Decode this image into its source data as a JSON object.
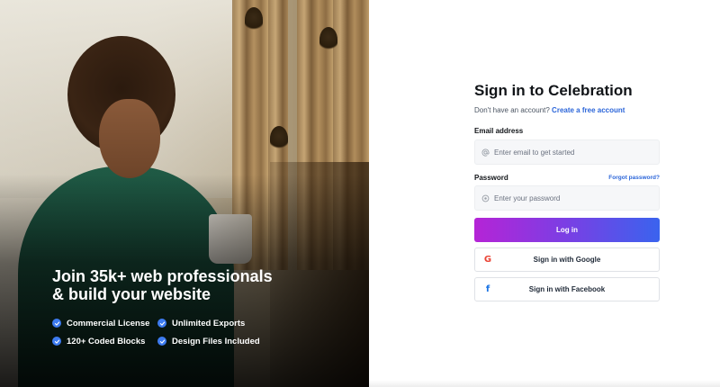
{
  "hero": {
    "title_line1": "Join 35k+ web professionals",
    "title_line2": "& build your website",
    "features": [
      {
        "label": "Commercial License",
        "icon": "check-circle-icon"
      },
      {
        "label": "Unlimited Exports",
        "icon": "check-circle-icon"
      },
      {
        "label": "120+ Coded Blocks",
        "icon": "check-circle-icon"
      },
      {
        "label": "Design Files Included",
        "icon": "check-circle-icon"
      }
    ]
  },
  "form": {
    "title": "Sign in to Celebration",
    "subtitle_text": "Don't have an account?",
    "subtitle_link": "Create a free account",
    "email": {
      "label": "Email address",
      "placeholder": "Enter email to get started",
      "value": "",
      "icon": "at-sign-icon"
    },
    "password": {
      "label": "Password",
      "placeholder": "Enter your password",
      "value": "",
      "icon": "lock-icon"
    },
    "forgot_label": "Forgot password?",
    "login_label": "Log in",
    "google_label": "Sign in with Google",
    "facebook_label": "Sign in with Facebook"
  },
  "colors": {
    "accent_blue": "#2b65d9",
    "gradient_start": "#b524d6",
    "gradient_end": "#3a63ee",
    "check_blue": "#3d7bf0"
  }
}
